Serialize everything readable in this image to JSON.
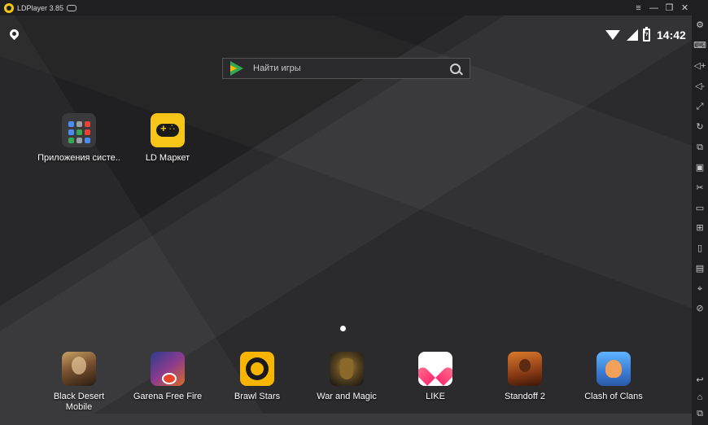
{
  "window": {
    "title": "LDPlayer 3.85",
    "controls": [
      "≡",
      "—",
      "❐",
      "✕",
      "«"
    ]
  },
  "statusbar": {
    "time": "14:42"
  },
  "search": {
    "placeholder": "Найти игры"
  },
  "desktop_apps": [
    {
      "label": "Приложения систе..",
      "icon": "system-apps-folder-icon"
    },
    {
      "label": "LD Маркет",
      "icon": "ld-market-icon"
    }
  ],
  "dock_apps": [
    {
      "label": "Black Desert Mobile",
      "icon": "black-desert-icon"
    },
    {
      "label": "Garena Free Fire",
      "icon": "free-fire-icon"
    },
    {
      "label": "Brawl Stars",
      "icon": "brawl-stars-icon"
    },
    {
      "label": "War and Magic",
      "icon": "war-and-magic-icon"
    },
    {
      "label": "LIKE",
      "icon": "like-icon"
    },
    {
      "label": "Standoff 2",
      "icon": "standoff-icon"
    },
    {
      "label": "Clash of Clans",
      "icon": "clash-of-clans-icon"
    }
  ],
  "toolbar": {
    "items": [
      {
        "icon": "settings-icon",
        "glyph": "⚙"
      },
      {
        "icon": "keyboard-icon",
        "glyph": "⌨"
      },
      {
        "icon": "volume-up-icon",
        "glyph": "◁+"
      },
      {
        "icon": "volume-down-icon",
        "glyph": "◁-"
      },
      {
        "icon": "fullscreen-icon",
        "glyph": "⤢"
      },
      {
        "icon": "rotate-icon",
        "glyph": "↻"
      },
      {
        "icon": "multi-instance-icon",
        "glyph": "⧉"
      },
      {
        "icon": "screenshot-icon",
        "glyph": "▣"
      },
      {
        "icon": "scissors-icon",
        "glyph": "✂"
      },
      {
        "icon": "record-icon",
        "glyph": "▭"
      },
      {
        "icon": "apk-install-icon",
        "glyph": "⊞"
      },
      {
        "icon": "shake-icon",
        "glyph": "▯"
      },
      {
        "icon": "operation-record-icon",
        "glyph": "▤"
      },
      {
        "icon": "location-icon",
        "glyph": "⌖"
      },
      {
        "icon": "sync-icon",
        "glyph": "⊘"
      },
      {
        "icon": "back-icon",
        "glyph": "↩"
      },
      {
        "icon": "home-icon",
        "glyph": "⌂"
      },
      {
        "icon": "recents-icon",
        "glyph": "⧉"
      }
    ]
  },
  "colors": {
    "accent": "#f5c518",
    "titlebar": "#1f1f22",
    "screen": "#2b2b2d"
  }
}
